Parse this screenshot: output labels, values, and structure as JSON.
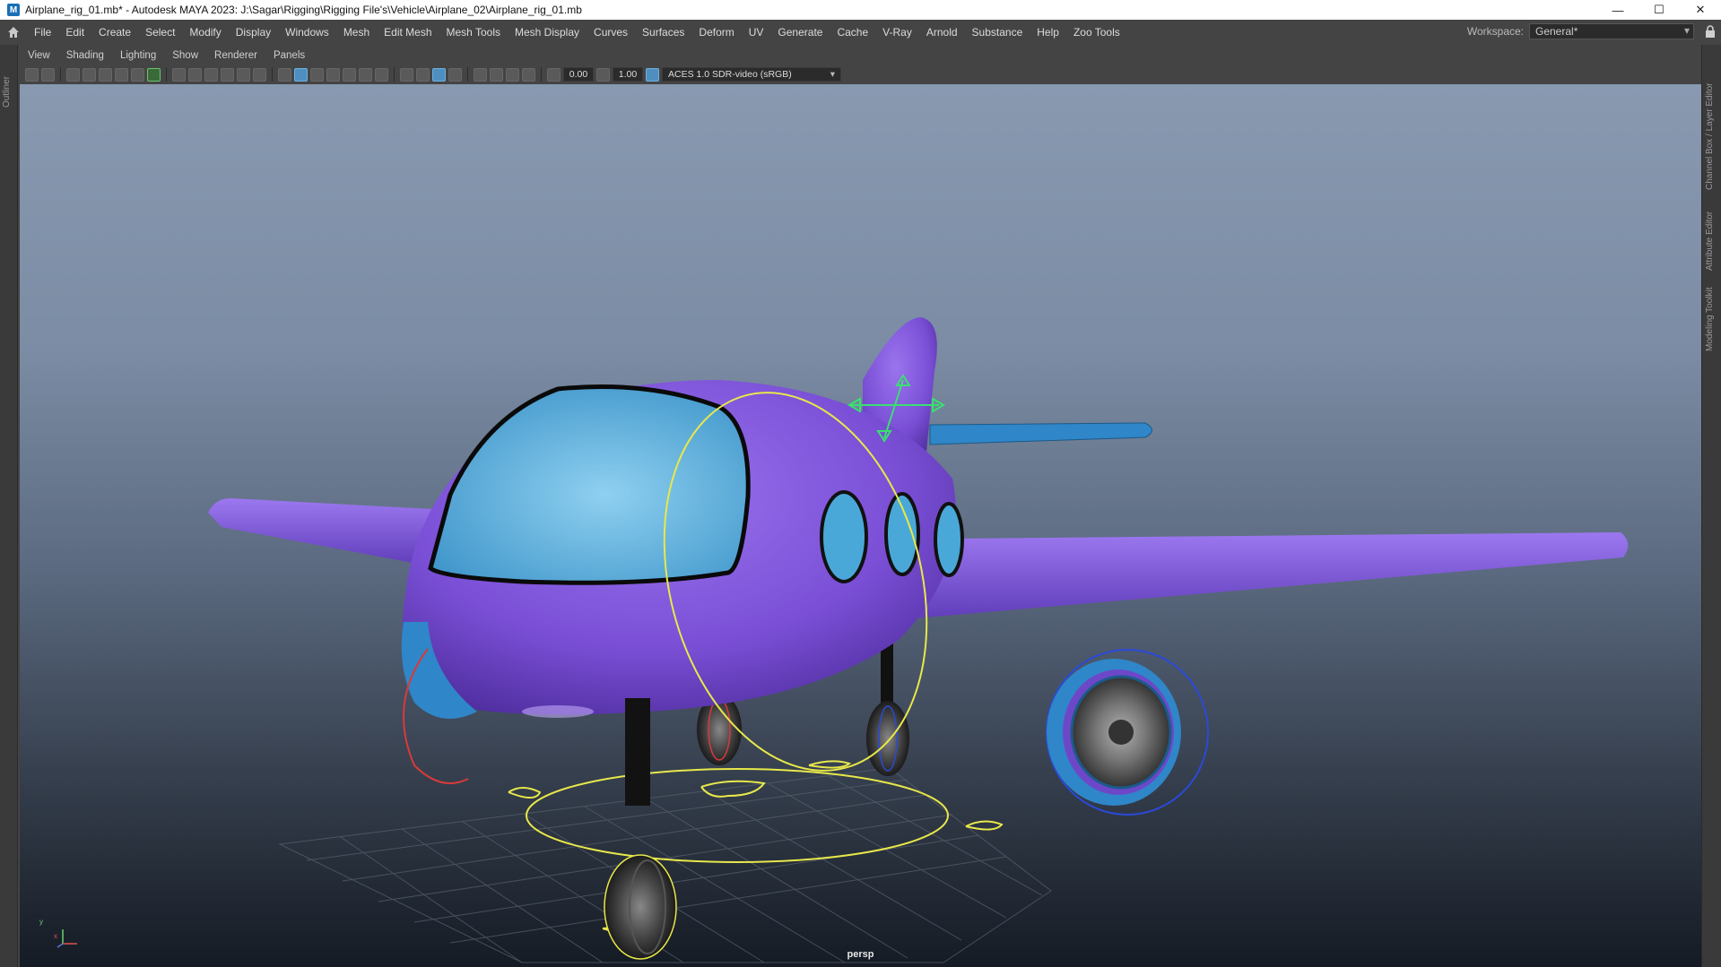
{
  "window": {
    "title": "Airplane_rig_01.mb* - Autodesk MAYA 2023: J:\\Sagar\\Rigging\\Rigging File's\\Vehicle\\Airplane_02\\Airplane_rig_01.mb",
    "minimize": "—",
    "maximize": "☐",
    "close": "✕"
  },
  "menubar": {
    "items": [
      "File",
      "Edit",
      "Create",
      "Select",
      "Modify",
      "Display",
      "Windows",
      "Mesh",
      "Edit Mesh",
      "Mesh Tools",
      "Mesh Display",
      "Curves",
      "Surfaces",
      "Deform",
      "UV",
      "Generate",
      "Cache",
      "V-Ray",
      "Arnold",
      "Substance",
      "Help",
      "Zoo Tools"
    ],
    "workspace_label": "Workspace:",
    "workspace_value": "General*"
  },
  "left_strip": {
    "label": "Outliner"
  },
  "right_strip": {
    "tabs": [
      "Channel Box / Layer Editor",
      "Attribute Editor",
      "Modeling Toolkit"
    ]
  },
  "panel_menu": {
    "items": [
      "View",
      "Shading",
      "Lighting",
      "Show",
      "Renderer",
      "Panels"
    ]
  },
  "toolbar": {
    "exposure": "0.00",
    "gamma": "1.00",
    "color_space": "ACES 1.0 SDR-video (sRGB)"
  },
  "viewport": {
    "camera": "persp",
    "axis_y": "y",
    "axis_x": "x",
    "colors": {
      "fuselage": "#7a4fd6",
      "glass": "#4aa8d8",
      "wing_tip": "#2f86c8",
      "control_yellow": "#e8e84a",
      "control_blue": "#2a4ad8",
      "control_red": "#d83a3a",
      "control_green": "#3ae070"
    }
  }
}
